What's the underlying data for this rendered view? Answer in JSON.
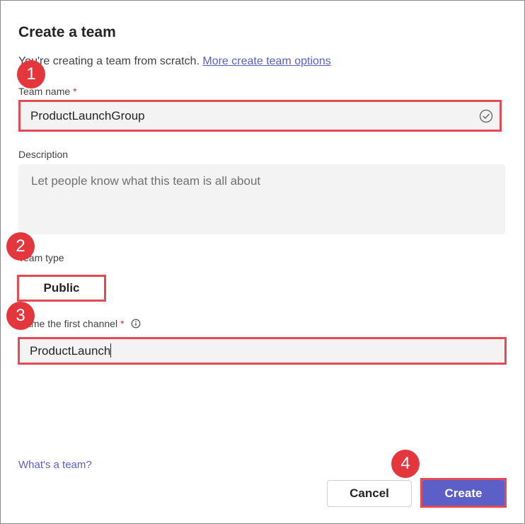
{
  "dialog": {
    "title": "Create a team",
    "subtitle_text": "You're creating a team from scratch.",
    "subtitle_link": "More create team options"
  },
  "team_name": {
    "label": "Team name",
    "required_mark": "*",
    "value": "ProductLaunchGroup"
  },
  "description": {
    "label": "Description",
    "placeholder": "Let people know what this team is all about"
  },
  "team_type": {
    "label": "Team type",
    "value": "Public"
  },
  "first_channel": {
    "label": "Name the first channel",
    "required_mark": "*",
    "value": "ProductLaunch"
  },
  "footer": {
    "whats_a_team": "What's a team?",
    "cancel_label": "Cancel",
    "create_label": "Create"
  },
  "steps": [
    "1",
    "2",
    "3",
    "4"
  ],
  "colors": {
    "accent": "#5b5fc7",
    "highlight": "#e34a53",
    "badge": "#e3373d",
    "required": "#c4314b"
  },
  "icons": {
    "team_name_status": "check-circle-icon",
    "channel_info": "info-icon"
  }
}
